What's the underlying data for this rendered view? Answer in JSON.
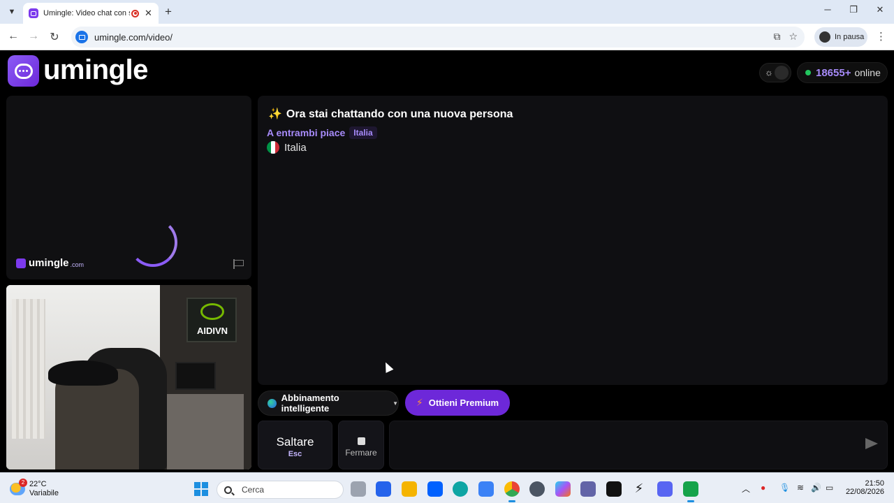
{
  "browser": {
    "tab_title": "Umingle: Video chat con sconosciuti",
    "url": "umingle.com/video/",
    "profile_label": "In pausa"
  },
  "header": {
    "logo_text": "umingle",
    "online_count": "18655+",
    "online_label": "online"
  },
  "remote": {
    "watermark_text": "umingle",
    "watermark_suffix": ".com"
  },
  "local_video": {
    "sign_text": "AIDIVN"
  },
  "chat": {
    "status_text": "Ora stai chattando con una nuova persona",
    "shared_label": "A entrambi piace",
    "shared_tag": "Italia",
    "partner_country": "Italia",
    "flag_colors": [
      "#009246",
      "#ffffff",
      "#ce2b37"
    ]
  },
  "controls": {
    "match_mode": "Abbinamento intelligente",
    "premium_label": "Ottieni Premium",
    "skip_label": "Saltare",
    "skip_key": "Esc",
    "stop_label": "Fermare",
    "message_placeholder": ""
  },
  "taskbar": {
    "weather_temp": "22°C",
    "weather_condition": "Variabile",
    "weather_badge": "2",
    "search_label": "Cerca",
    "time": "21:50",
    "date": "22/08/2026"
  },
  "colors": {
    "accent": "#7c3aed",
    "online_dot": "#22c55e",
    "chat_bg": "#0f0f12"
  }
}
